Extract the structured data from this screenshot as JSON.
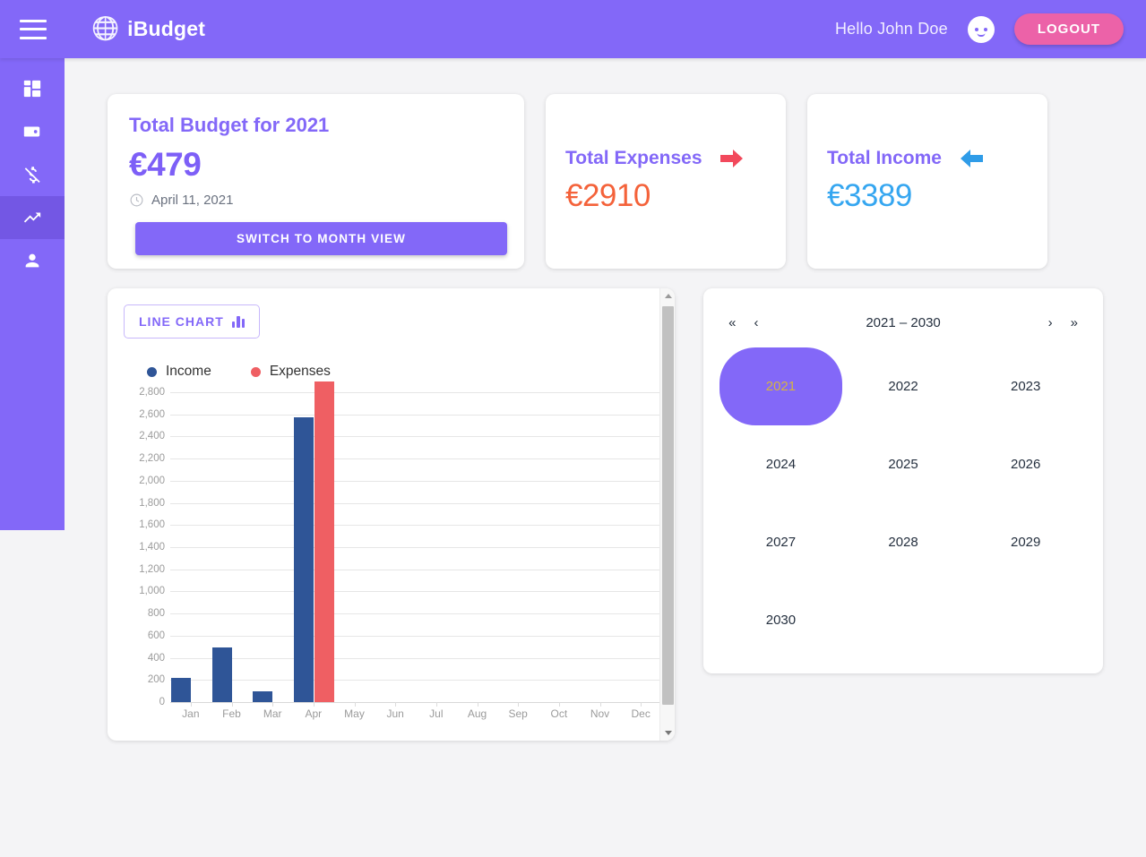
{
  "app": {
    "brand": "iBudget",
    "logo_icon": "globe-search-icon",
    "menu_icon": "hamburger-menu-icon",
    "accent_purple": "#8368f8",
    "accent_pink": "#ec62a8",
    "page_background": "#f4f4f6"
  },
  "header": {
    "greeting": "Hello John Doe",
    "avatar_icon": "user-face-avatar-icon",
    "logout_label": "LOGOUT"
  },
  "sidebar": {
    "items": [
      {
        "icon": "dashboard-grid-icon",
        "name": "dashboard",
        "active": false
      },
      {
        "icon": "wallet-icon",
        "name": "wallet",
        "active": false
      },
      {
        "icon": "money-off-icon",
        "name": "expenses",
        "active": false
      },
      {
        "icon": "trending-up-icon",
        "name": "statistics",
        "active": true
      },
      {
        "icon": "person-icon",
        "name": "profile",
        "active": false
      }
    ]
  },
  "budget_card": {
    "title": "Total Budget for 2021",
    "amount": "€479",
    "date_icon": "clock-icon",
    "date": "April 11, 2021",
    "switch_button_label": "SWITCH TO MONTH VIEW"
  },
  "expenses_card": {
    "title": "Total Expenses",
    "icon": "arrow-right-icon",
    "icon_color": "#f2495c",
    "amount": "€2910",
    "amount_color": "#f4623a"
  },
  "income_card": {
    "title": "Total Income",
    "icon": "arrow-left-icon",
    "icon_color": "#2f9ce8",
    "amount": "€3389",
    "amount_color": "#35a6f0"
  },
  "chart_panel": {
    "toggle_button_label": "LINE CHART",
    "toggle_button_icon": "bar-chart-icon",
    "scrollbar": {
      "up_arrow_icon": "scroll-up-arrow-icon",
      "down_arrow_icon": "scroll-down-arrow-icon"
    }
  },
  "chart_data": {
    "type": "bar",
    "title": "",
    "xlabel": "",
    "ylabel": "",
    "grid": true,
    "legend_position": "top-left",
    "categories": [
      "Jan",
      "Feb",
      "Mar",
      "Apr",
      "May",
      "Jun",
      "Jul",
      "Aug",
      "Sep",
      "Oct",
      "Nov",
      "Dec"
    ],
    "ylim": [
      0,
      2800
    ],
    "yticks": [
      0,
      200,
      400,
      600,
      800,
      1000,
      1200,
      1400,
      1600,
      1800,
      2000,
      2200,
      2400,
      2600,
      2800
    ],
    "ytick_labels": [
      "0",
      "200",
      "400",
      "600",
      "800",
      "1,000",
      "1,200",
      "1,400",
      "1,600",
      "1,800",
      "2,000",
      "2,200",
      "2,400",
      "2,600",
      "2,800"
    ],
    "series": [
      {
        "name": "Income",
        "color": "#2f5597",
        "values": [
          215,
          490,
          100,
          2575,
          0,
          0,
          0,
          0,
          0,
          0,
          0,
          0
        ]
      },
      {
        "name": "Expenses",
        "color": "#ef5f63",
        "values": [
          0,
          0,
          0,
          2900,
          0,
          0,
          0,
          0,
          0,
          0,
          0,
          0
        ]
      }
    ]
  },
  "year_picker": {
    "prev_decade_label": "«",
    "prev_label": "‹",
    "range_label": "2021 – 2030",
    "next_label": "›",
    "next_decade_label": "»",
    "selected_year": "2021",
    "years": [
      "2021",
      "2022",
      "2023",
      "2024",
      "2025",
      "2026",
      "2027",
      "2028",
      "2029",
      "2030",
      "",
      ""
    ]
  }
}
